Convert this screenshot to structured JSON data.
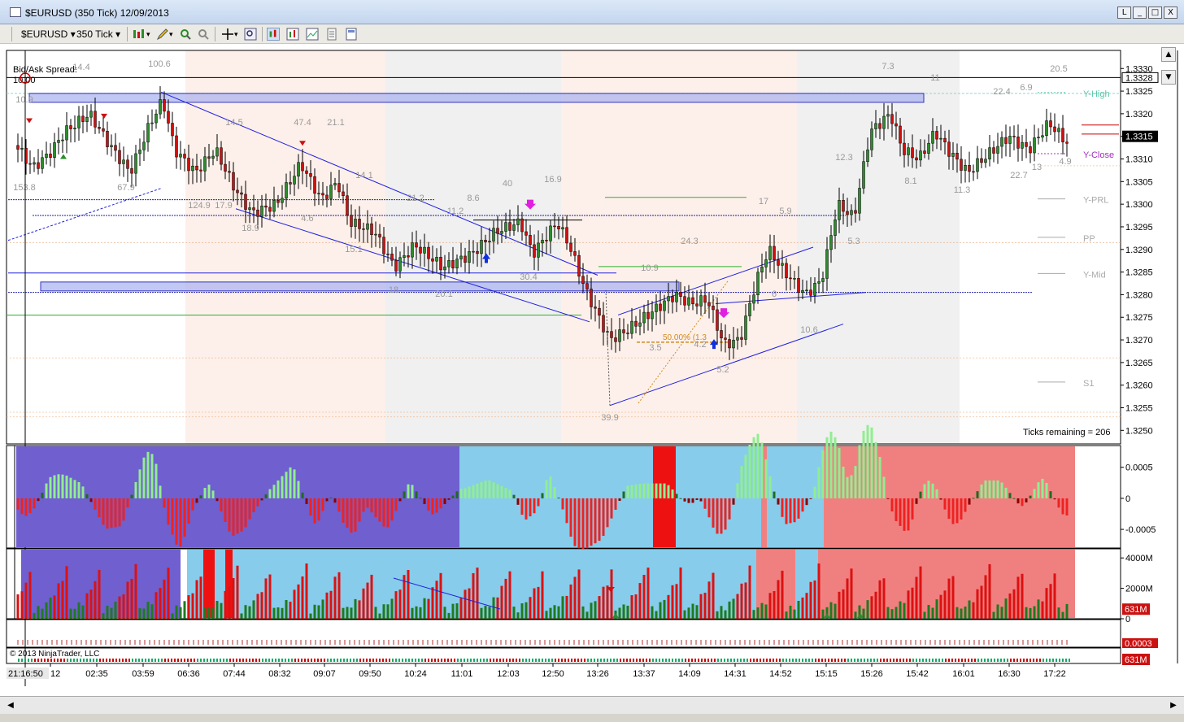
{
  "window": {
    "title": "$EURUSD (350 Tick)  12/09/2013",
    "min_label": "_",
    "max_label": "□",
    "close_label": "X",
    "restore_label": "L"
  },
  "toolbar": {
    "instrument": "$EURUSD",
    "period": "350 Tick"
  },
  "price_axis": {
    "ticks": [
      "1.3330",
      "1.3325",
      "1.3320",
      "1.3315",
      "1.3310",
      "1.3305",
      "1.3300",
      "1.3295",
      "1.3290",
      "1.3285",
      "1.3280",
      "1.3275",
      "1.3270",
      "1.3265",
      "1.3260",
      "1.3255",
      "1.3250"
    ],
    "y_high_marker": "1.3328",
    "last_price": "1.3315"
  },
  "price_panel": {
    "bid_ask_label": "Bid/Ask Spread:",
    "spread_value": "10.00",
    "ticks_remaining": "Ticks remaining = 206",
    "fib_label": "50.00% (1.3",
    "pivots": [
      {
        "label": "Y-High",
        "color": "#5ac6a8"
      },
      {
        "label": "Y-Close",
        "color": "#a030c0"
      },
      {
        "label": "Y-PRL",
        "color": "#aaaaaa"
      },
      {
        "label": "PP",
        "color": "#aaaaaa"
      },
      {
        "label": "Y-Mid",
        "color": "#aaaaaa"
      },
      {
        "label": "S1",
        "color": "#aaaaaa"
      }
    ],
    "annotations": [
      "100.6",
      "14.4",
      "10.9",
      "153.8",
      "67.9",
      "124.9",
      "17.9",
      "14.5",
      "18.9",
      "47.4",
      "21.1",
      "14.1",
      "4.6",
      "15.1",
      "21.2",
      "18",
      "20.1",
      "8.6",
      "11.2",
      "40",
      "16.9",
      "30.4",
      "10.9",
      "24.3",
      "3.5",
      "4.2",
      "5.2",
      "39.9",
      "17",
      "5.9",
      "6",
      "10.6",
      "5.3",
      "12.3",
      "7.3",
      "11",
      "8.1",
      "11.3",
      "22.4",
      "6.9",
      "20.5",
      "22.7",
      "13",
      "4.9"
    ]
  },
  "osc_axis": {
    "ticks": [
      "0.0005",
      "0",
      "-0.0005"
    ]
  },
  "vol_axis": {
    "ticks": [
      "4000M",
      "2000M",
      "0"
    ],
    "last_value": "631M"
  },
  "small_panel": {
    "value": "0.0003"
  },
  "bottom_panel": {
    "value": "631M",
    "copyright": "© 2013 NinjaTrader, LLC"
  },
  "time_axis": {
    "cursor_time": "21:16:50",
    "labels": [
      "12",
      "02:35",
      "03:59",
      "06:36",
      "07:44",
      "08:32",
      "09:07",
      "09:50",
      "10:24",
      "11:01",
      "12:03",
      "12:50",
      "13:26",
      "13:37",
      "14:09",
      "14:31",
      "14:52",
      "15:15",
      "15:26",
      "15:42",
      "16:01",
      "16:30",
      "17:22"
    ]
  },
  "colors": {
    "bull": "#2e8b2e",
    "bear": "#cc1111",
    "zone_blue": "#6f5fcf",
    "zone_light": "#87cceb",
    "zone_red": "#f08080",
    "trend": "#2020dd"
  },
  "icons": [
    "bar-type-icon",
    "pencil-icon",
    "zoom-icon",
    "crosshair-icon",
    "magnifier-icon",
    "chart-style-icon",
    "properties-icon",
    "template-icon"
  ]
}
